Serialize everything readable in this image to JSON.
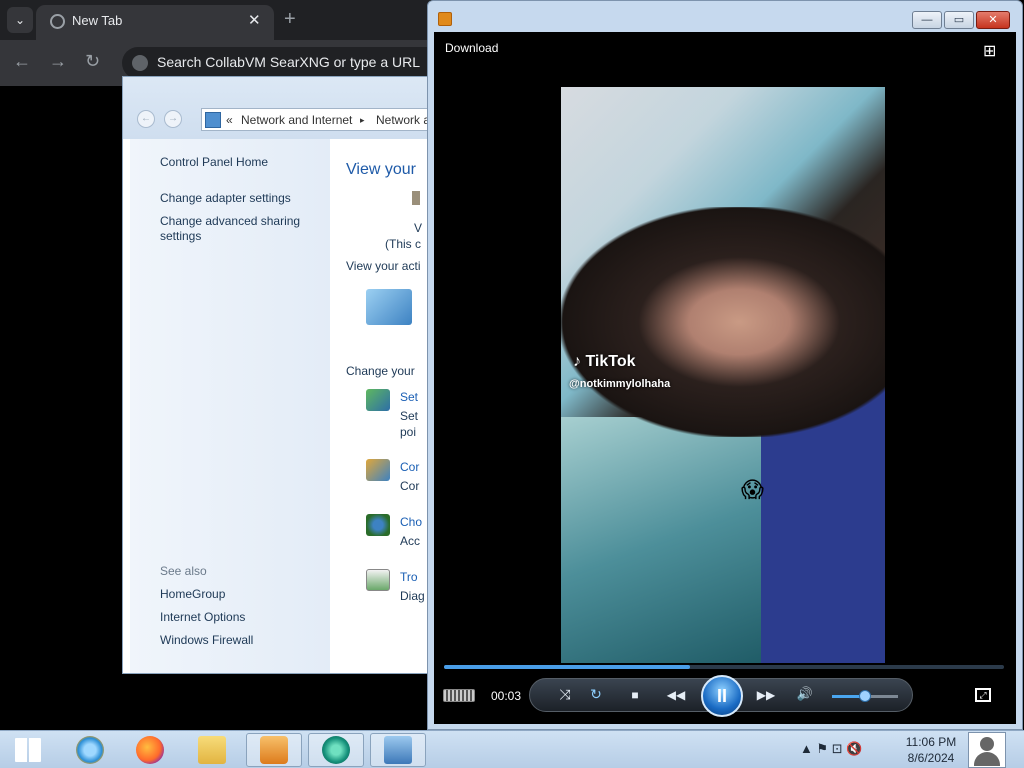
{
  "browser": {
    "tab_title": "New Tab",
    "tab_close": "✕",
    "new_tab": "+",
    "menu_glyph": "⌄",
    "back": "←",
    "forward": "→",
    "reload": "↻",
    "omnibox_placeholder": "Search CollabVM SearXNG or type a URL"
  },
  "control_panel": {
    "nav_back": "←",
    "nav_forward": "→",
    "breadcrumb_sep": "«",
    "breadcrumb": [
      "Network and Internet",
      "Network a"
    ],
    "crumb_arrow": "▸",
    "sidebar": {
      "home": "Control Panel Home",
      "links": [
        "Change adapter settings",
        "Change advanced sharing settings"
      ],
      "see_also_title": "See also",
      "see_also": [
        "HomeGroup",
        "Internet Options",
        "Windows Firewall"
      ]
    },
    "main": {
      "title": "View your",
      "line_v": "V",
      "line_this": "(This c",
      "active": "View your acti",
      "change": "Change your",
      "tasks": [
        {
          "link": "Set",
          "desc": [
            "Set",
            "poi"
          ]
        },
        {
          "link": "Cor",
          "desc": [
            "Cor"
          ]
        },
        {
          "link": "Cho",
          "desc": [
            "Acc"
          ]
        },
        {
          "link": "Tro",
          "desc": [
            "Diag"
          ]
        }
      ]
    }
  },
  "media_player": {
    "minimize": "—",
    "restore": "▭",
    "close": "✕",
    "download_label": "Download",
    "switch_glyph": "⊞",
    "video": {
      "watermark": "♪ TikTok",
      "handle": "@notkimmylolhaha",
      "emoji": "😱"
    },
    "time": "00:03",
    "progress_fraction": 0.44,
    "volume_fraction": 0.5,
    "controls": {
      "shuffle": "⤨",
      "repeat": "↻",
      "stop": "■",
      "prev": "◀◀",
      "play_pause": "II",
      "next": "▶▶",
      "mute": "🔊",
      "fullscreen": "⤢"
    }
  },
  "taskbar": {
    "items": [
      "start-icon",
      "ie-icon",
      "firefox-icon",
      "explorer-icon",
      "media-player-icon",
      "messenger-icon",
      "control-panel-icon"
    ],
    "tray_glyphs": "▲  ⚑  ⊡  🔇",
    "clock_time": "11:06 PM",
    "clock_date": "8/6/2024"
  }
}
